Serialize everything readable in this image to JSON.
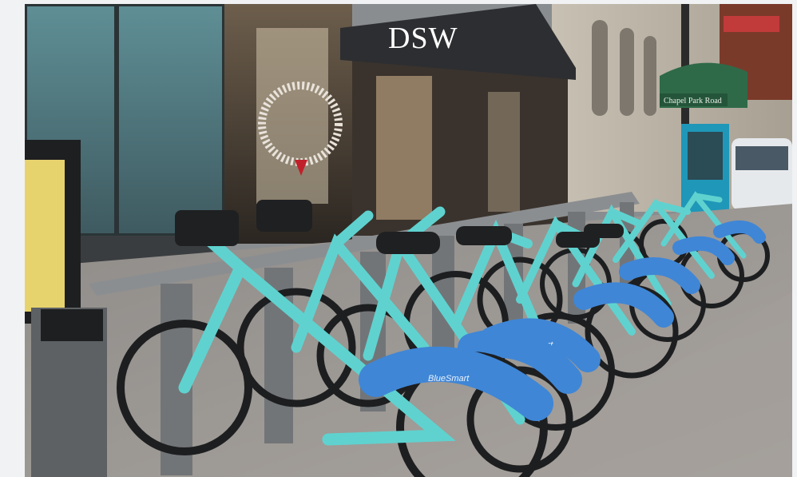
{
  "photo": {
    "store_sign": "DSW",
    "street_sign": "Chapel Park Road",
    "bike_brand": "BlueSmart",
    "colors": {
      "bike_frame": "#5fd2cf",
      "fender": "#3f86d6",
      "awning": "#2d2e31",
      "sidewalk": "#9a9591",
      "street_sign": "#2f6a48",
      "kiosk": "#1f97b8"
    }
  }
}
